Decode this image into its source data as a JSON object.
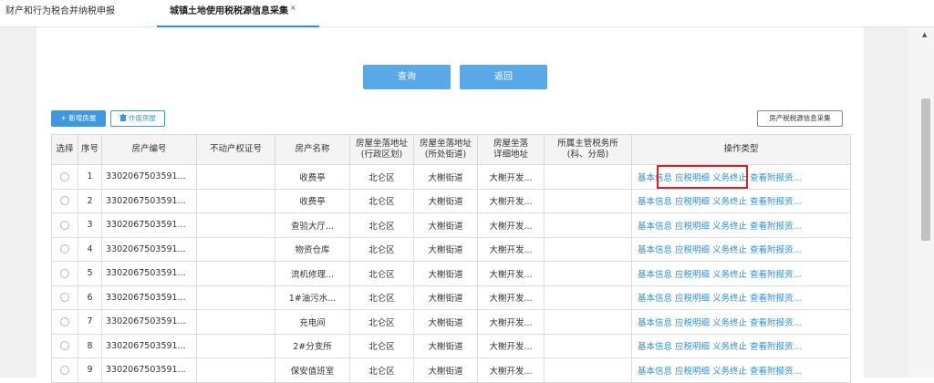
{
  "tabs": {
    "tab1": "财产和行为税合并纳税申报",
    "tab2": "城镇土地使用税税源信息采集",
    "tab2_close": "×"
  },
  "buttons": {
    "query": "查询",
    "back": "返回",
    "add_property": "新增房屋",
    "void_property": "作废房屋",
    "collect_info": "房产税税源信息采集"
  },
  "table": {
    "headers": {
      "select": "选择",
      "seq": "序号",
      "property_no": "房产编号",
      "cert_no": "不动产权证号",
      "name": "房产名称",
      "addr_region_1": "房屋坐落地址",
      "addr_region_2": "(行政区划)",
      "addr_street_1": "房屋坐落地址",
      "addr_street_2": "(所处街道)",
      "addr_detail_1": "房屋坐落",
      "addr_detail_2": "详细地址",
      "tax_office_1": "所属主管税务所",
      "tax_office_2": "(科、分局)",
      "ops": "操作类型"
    },
    "op_labels": {
      "basic": "基本信息",
      "detail": "应税明细",
      "terminate": "义务终止",
      "view": "查看附报资..."
    },
    "rows": [
      {
        "seq": "1",
        "property_no": "3302067503591...",
        "cert_no": "",
        "name": "收费亭",
        "region": "北仑区",
        "street": "大榭街道",
        "detail": "大榭开发...",
        "office": ""
      },
      {
        "seq": "2",
        "property_no": "3302067503591...",
        "cert_no": "",
        "name": "收费亭",
        "region": "北仑区",
        "street": "大榭街道",
        "detail": "大榭开发...",
        "office": ""
      },
      {
        "seq": "3",
        "property_no": "3302067503591...",
        "cert_no": "",
        "name": "查验大厅...",
        "region": "北仑区",
        "street": "大榭街道",
        "detail": "大榭开发...",
        "office": ""
      },
      {
        "seq": "4",
        "property_no": "3302067503591...",
        "cert_no": "",
        "name": "物资仓库",
        "region": "北仑区",
        "street": "大榭街道",
        "detail": "大榭开发...",
        "office": ""
      },
      {
        "seq": "5",
        "property_no": "3302067503591...",
        "cert_no": "",
        "name": "流机修理...",
        "region": "北仑区",
        "street": "大榭街道",
        "detail": "大榭开发...",
        "office": ""
      },
      {
        "seq": "6",
        "property_no": "3302067503591...",
        "cert_no": "",
        "name": "1#油污水...",
        "region": "北仑区",
        "street": "大榭街道",
        "detail": "大榭开发...",
        "office": ""
      },
      {
        "seq": "7",
        "property_no": "3302067503591...",
        "cert_no": "",
        "name": "充电间",
        "region": "北仑区",
        "street": "大榭街道",
        "detail": "大榭开发...",
        "office": ""
      },
      {
        "seq": "8",
        "property_no": "3302067503591...",
        "cert_no": "",
        "name": "2#分变所",
        "region": "北仑区",
        "street": "大榭街道",
        "detail": "大榭开发...",
        "office": ""
      },
      {
        "seq": "9",
        "property_no": "3302067503591...",
        "cert_no": "",
        "name": "保安值班室",
        "region": "北仑区",
        "street": "大榭街道",
        "detail": "大榭开发...",
        "office": ""
      }
    ]
  },
  "colors": {
    "accent": "#3e97df",
    "highlight": "#e02020"
  }
}
